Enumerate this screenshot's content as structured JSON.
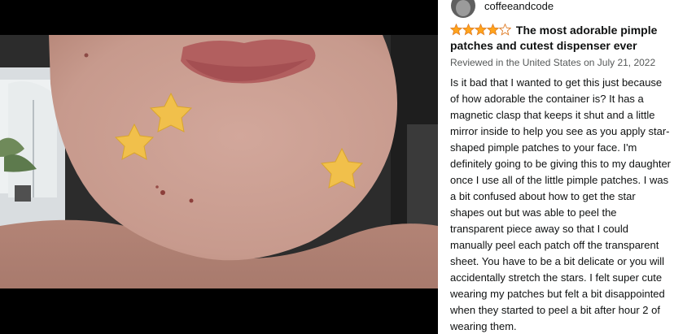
{
  "review": {
    "author": "coffeeandcode",
    "rating": 4,
    "rating_max": 5,
    "title": "The most adorable pimple patches and cutest dispenser ever",
    "meta": "Reviewed in the United States on July 21, 2022",
    "body": "Is it bad that I wanted to get this just because of how adorable the container is? It has a magnetic clasp that keeps it shut and a little mirror inside to help you see as you apply star-shaped pimple patches to your face. I'm definitely going to be giving this to my daughter once I use all of the little pimple patches. I was a bit confused about how to get the star shapes out but was able to peel the transparent piece away so that I could manually peel each patch off the transparent sheet. You have to be a bit delicate or you will accidentally stretch the stars. I felt super cute wearing my patches but felt a bit disappointed when they started to peel a bit after hour 2 of wearing them."
  },
  "colors": {
    "star_fill": "#ffa41c",
    "star_outline": "#de7921",
    "text": "#0f1111",
    "meta_text": "#565959",
    "viewer_bg": "#000000"
  },
  "icons": [
    "user-avatar-icon",
    "star-icon"
  ]
}
